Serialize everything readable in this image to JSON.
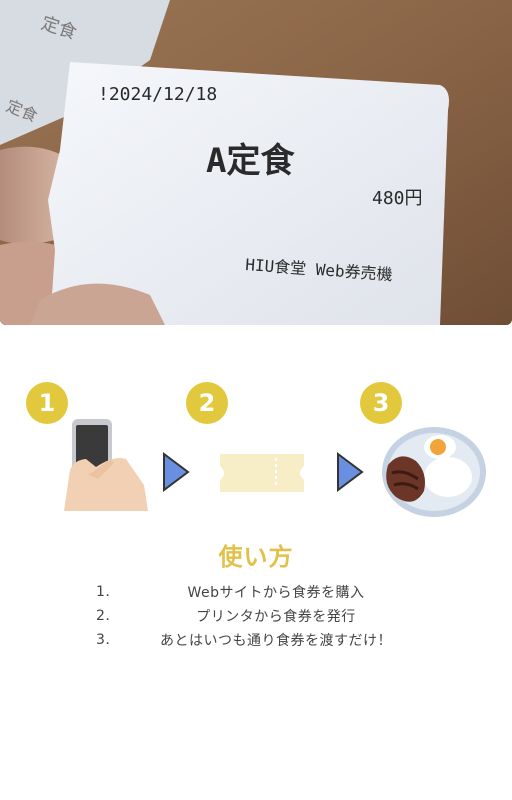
{
  "photo": {
    "ticket_date": "!2024/12/18",
    "ticket_item": "A定食",
    "ticket_price": "480円",
    "ticket_shop": "HIU食堂 Web券売機",
    "back_ticket_text": "定食"
  },
  "steps": [
    {
      "number": "1",
      "icon": "smartphone-hand-icon"
    },
    {
      "number": "2",
      "icon": "ticket-icon"
    },
    {
      "number": "3",
      "icon": "meal-plate-icon"
    }
  ],
  "how_to": {
    "title": "使い方",
    "items": [
      {
        "num": "1.",
        "text": "Webサイトから食券を購入"
      },
      {
        "num": "2.",
        "text": "プリンタから食券を発行"
      },
      {
        "num": "3.",
        "text": "あとはいつも通り食券を渡すだけ！"
      }
    ]
  },
  "colors": {
    "accent": "#e1c83c",
    "title": "#e2c14a",
    "arrow": "#6a8fe0",
    "ticket_fill": "#f7edc7"
  }
}
